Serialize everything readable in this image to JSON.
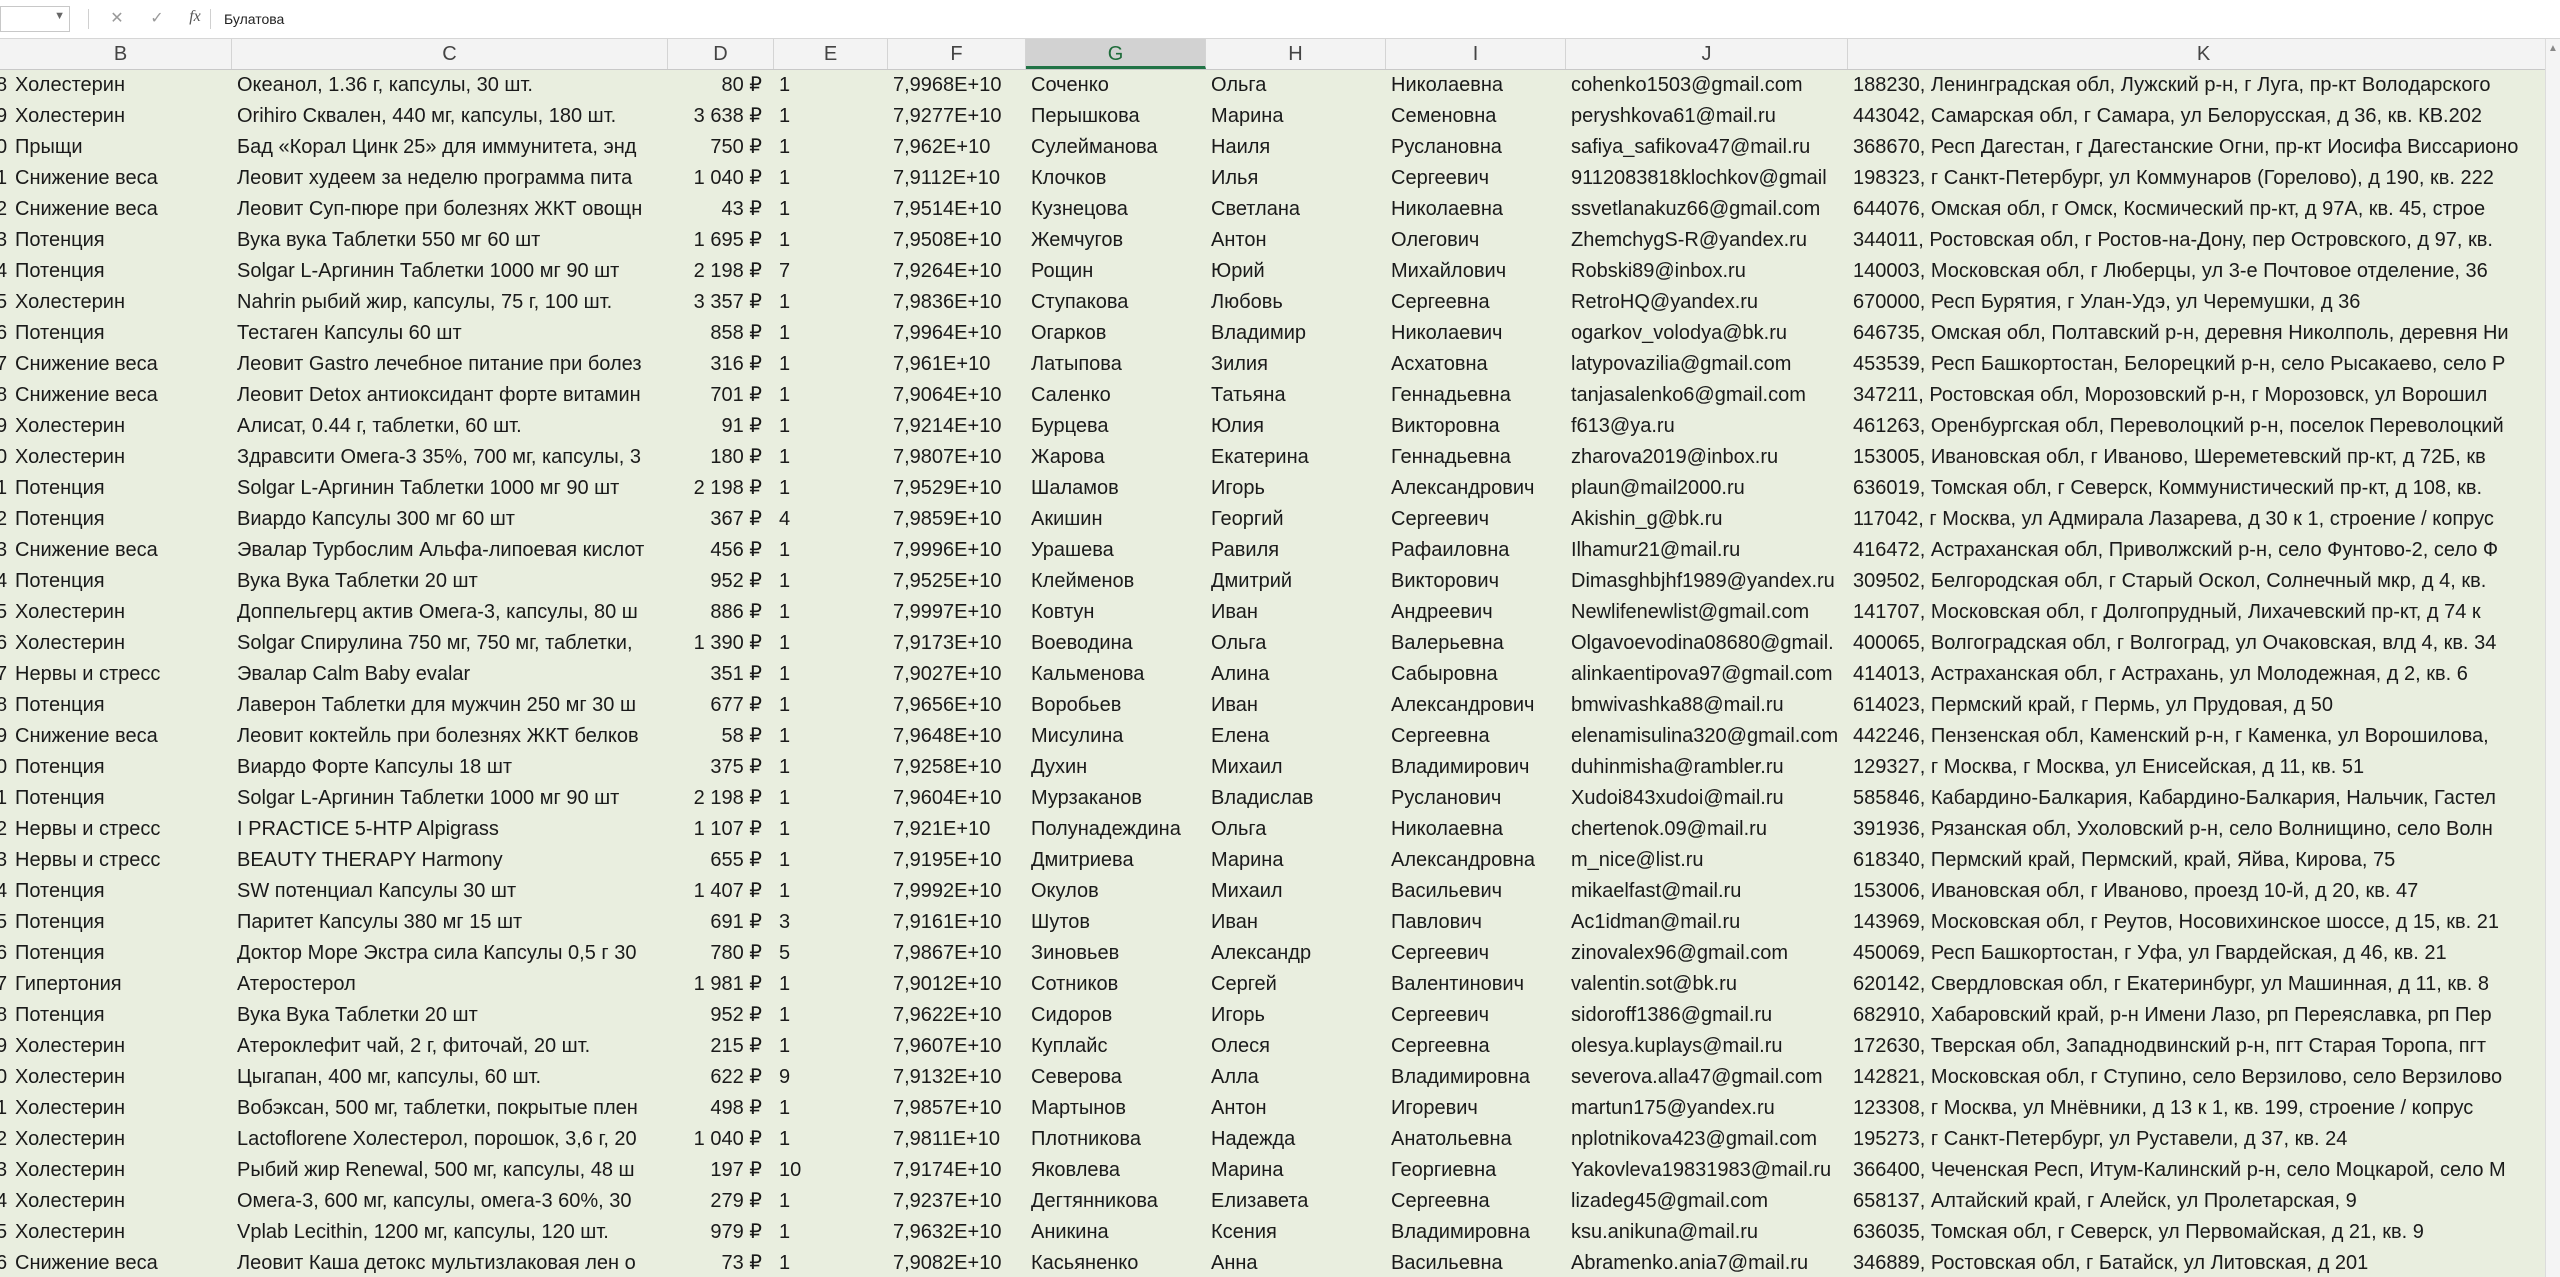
{
  "formula_bar": {
    "name_box": "",
    "cancel_icon": "close-icon",
    "enter_icon": "check-icon",
    "fx_label": "fx",
    "value": "Булатова"
  },
  "columns": [
    "B",
    "C",
    "D",
    "E",
    "F",
    "G",
    "H",
    "I",
    "J",
    "K"
  ],
  "selected_column": "G",
  "rows": [
    [
      "8",
      "Холестерин",
      "Океанол, 1.36 г, капсулы, 30 шт.",
      "80 ₽",
      "1",
      "7,9968E+10",
      "Соченко",
      "Ольга",
      "Николаевна",
      "cohenko1503@gmail.com",
      "188230, Ленинградская обл, Лужский р-н, г Луга, пр-кт Володарского"
    ],
    [
      "9",
      "Холестерин",
      "Orihiro Сквален, 440 мг, капсулы, 180 шт.",
      "3 638 ₽",
      "1",
      "7,9277E+10",
      "Перышкова",
      "Марина",
      "Семеновна",
      "peryshkova61@mail.ru",
      "443042, Самарская обл, г Самара, ул Белорусская, д 36, кв. КВ.202"
    ],
    [
      "0",
      "Прыщи",
      "Бад «Корал Цинк 25» для иммунитета, энд",
      "750 ₽",
      "1",
      "7,962E+10",
      "Сулейманова",
      "Наиля",
      "Руслановна",
      "safiya_safikova47@mail.ru",
      "368670, Респ Дагестан, г Дагестанские Огни, пр-кт Иосифа Виссарионо"
    ],
    [
      "1",
      "Снижение веса",
      "Леовит худеем за неделю программа пита",
      "1 040 ₽",
      "1",
      "7,9112E+10",
      "Клочков",
      "Илья",
      "Сергеевич",
      "9112083818klochkov@gmail",
      "198323, г Санкт-Петербург, ул Коммунаров (Горелово), д 190, кв. 222"
    ],
    [
      "2",
      "Снижение веса",
      "Леовит Суп-пюре при болезнях ЖКТ овощн",
      "43 ₽",
      "1",
      "7,9514E+10",
      "Кузнецова",
      "Светлана",
      "Николаевна",
      "ssvetlanakuz66@gmail.com",
      "644076, Омская обл, г Омск, Космический пр-кт, д 97А, кв. 45, строе"
    ],
    [
      "3",
      "Потенция",
      "Вука вука Таблетки 550 мг 60 шт",
      "1 695 ₽",
      "1",
      "7,9508E+10",
      "Жемчугов",
      "Антон",
      "Олегович",
      "ZhemchygS-R@yandex.ru",
      "344011, Ростовская обл, г Ростов-на-Дону, пер Островского, д 97, кв."
    ],
    [
      "4",
      "Потенция",
      "Solgar L-Аргинин Таблетки 1000 мг 90 шт",
      "2 198 ₽",
      "7",
      "7,9264E+10",
      "Рощин",
      "Юрий",
      "Михайлович",
      "Robski89@inbox.ru",
      "140003, Московская обл, г Люберцы, ул 3-е Почтовое отделение, 36"
    ],
    [
      "5",
      "Холестерин",
      "Nahrin рыбий жир, капсулы, 75 г, 100 шт.",
      "3 357 ₽",
      "1",
      "7,9836E+10",
      "Ступакова",
      "Любовь",
      "Сергеевна",
      "RetroHQ@yandex.ru",
      "670000, Респ Бурятия, г Улан-Удэ, ул Черемушки, д 36"
    ],
    [
      "6",
      "Потенция",
      "Тестаген Капсулы 60 шт",
      "858 ₽",
      "1",
      "7,9964E+10",
      "Огарков",
      "Владимир",
      "Николаевич",
      "ogarkov_volodya@bk.ru",
      "646735, Омская обл, Полтавский р-н, деревня Николполь, деревня Ни"
    ],
    [
      "7",
      "Снижение веса",
      "Леовит Gastro лечебное питание при болез",
      "316 ₽",
      "1",
      "7,961E+10",
      "Латыпова",
      "Зилия",
      "Асхатовна",
      "latypovazilia@gmail.com",
      "453539, Респ Башкортостан, Белорецкий р-н, село Рысакаево, село Р"
    ],
    [
      "8",
      "Снижение веса",
      "Леовит Detox антиоксидант форте витамин",
      "701 ₽",
      "1",
      "7,9064E+10",
      "Саленко",
      "Татьяна",
      "Геннадьевна",
      "tanjasalenko6@gmail.com",
      "347211, Ростовская обл, Морозовский р-н, г Морозовск, ул Ворошил"
    ],
    [
      "9",
      "Холестерин",
      "Алисат, 0.44 г, таблетки, 60 шт.",
      "91 ₽",
      "1",
      "7,9214E+10",
      "Бурцева",
      "Юлия",
      "Викторовна",
      "f613@ya.ru",
      "461263, Оренбургская обл, Переволоцкий р-н, поселок Переволоцкий"
    ],
    [
      "0",
      "Холестерин",
      "Здравсити Омега-3 35%, 700 мг, капсулы, 3",
      "180 ₽",
      "1",
      "7,9807E+10",
      "Жарова",
      "Екатерина",
      "Геннадьевна",
      "zharova2019@inbox.ru",
      "153005, Ивановская обл, г Иваново, Шереметевский пр-кт, д 72Б, кв"
    ],
    [
      "1",
      "Потенция",
      "Solgar L-Аргинин Таблетки 1000 мг 90 шт",
      "2 198 ₽",
      "1",
      "7,9529E+10",
      "Шаламов",
      "Игорь",
      "Александрович",
      "plaun@mail2000.ru",
      "636019, Томская обл, г Северск, Коммунистический пр-кт, д 108, кв."
    ],
    [
      "2",
      "Потенция",
      "Виардо Капсулы 300 мг 60 шт",
      "367 ₽",
      "4",
      "7,9859E+10",
      "Акишин",
      "Георгий",
      "Сергеевич",
      "Akishin_g@bk.ru",
      "117042, г Москва, ул Адмирала Лазарева, д 30 к 1, строение / копрус"
    ],
    [
      "3",
      "Снижение веса",
      "Эвалар Турбослим Альфа-липоевая кислот",
      "456 ₽",
      "1",
      "7,9996E+10",
      "Урашева",
      "Равиля",
      "Рафаиловна",
      "Ilhamur21@mail.ru",
      "416472, Астраханская обл, Приволжский р-н, село Фунтово-2, село Ф"
    ],
    [
      "4",
      "Потенция",
      "Вука Вука Таблетки 20 шт",
      "952 ₽",
      "1",
      "7,9525E+10",
      "Клейменов",
      "Дмитрий",
      "Викторович",
      "Dimasghbjhf1989@yandex.ru",
      "309502, Белгородская обл, г Старый Оскол, Солнечный мкр, д 4, кв."
    ],
    [
      "5",
      "Холестерин",
      "Доппельгерц актив Омега-3, капсулы, 80 ш",
      "886 ₽",
      "1",
      "7,9997E+10",
      "Ковтун",
      "Иван",
      "Андреевич",
      "Newlifenewlist@gmail.com",
      "141707, Московская обл, г Долгопрудный, Лихачевский пр-кт, д 74 к"
    ],
    [
      "6",
      "Холестерин",
      "Solgar Спирулина 750 мг, 750 мг, таблетки,",
      "1 390 ₽",
      "1",
      "7,9173E+10",
      "Воеводина",
      "Ольга",
      "Валерьевна",
      "Olgavoevodina08680@gmail.",
      "400065, Волгоградская обл, г Волгоград, ул Очаковская, влд 4, кв. 34"
    ],
    [
      "7",
      "Нервы и стресс",
      "Эвалар Calm Baby evalar",
      "351 ₽",
      "1",
      "7,9027E+10",
      "Кальменова",
      "Алина",
      "Сабыровна",
      "alinkaentipova97@gmail.com",
      "414013, Астраханская обл, г Астрахань, ул Молодежная, д 2, кв. 6"
    ],
    [
      "8",
      "Потенция",
      "Лаверон Таблетки для мужчин 250 мг 30 ш",
      "677 ₽",
      "1",
      "7,9656E+10",
      "Воробьев",
      "Иван",
      "Александрович",
      "bmwivashka88@mail.ru",
      "614023, Пермский край, г Пермь, ул Прудовая, д 50"
    ],
    [
      "9",
      "Снижение веса",
      "Леовит коктейль при болезнях ЖКТ белков",
      "58 ₽",
      "1",
      "7,9648E+10",
      "Мисулина",
      "Елена",
      "Сергеевна",
      "elenamisulina320@gmail.com",
      "442246, Пензенская обл, Каменский р-н, г Каменка, ул Ворошилова,"
    ],
    [
      "0",
      "Потенция",
      "Виардо Форте Капсулы 18 шт",
      "375 ₽",
      "1",
      "7,9258E+10",
      "Духин",
      "Михаил",
      "Владимирович",
      "duhinmisha@rambler.ru",
      "129327, г Москва, г Москва, ул Енисейская, д 11, кв. 51"
    ],
    [
      "1",
      "Потенция",
      "Solgar L-Аргинин Таблетки 1000 мг 90 шт",
      "2 198 ₽",
      "1",
      "7,9604E+10",
      "Мурзаканов",
      "Владислав",
      "Русланович",
      "Xudoi843xudoi@mail.ru",
      "585846, Кабардино-Балкария, Кабардино-Балкария, Нальчик, Гастел"
    ],
    [
      "2",
      "Нервы и стресс",
      "I PRACTICE 5-HTP Alpigrass",
      "1 107 ₽",
      "1",
      "7,921E+10",
      "Полунадеждина",
      "Ольга",
      "Николаевна",
      "chertenok.09@mail.ru",
      "391936, Рязанская обл, Ухоловский р-н, село Волнищино, село Волн"
    ],
    [
      "3",
      "Нервы и стресс",
      "BEAUTY THERAPY Harmony",
      "655 ₽",
      "1",
      "7,9195E+10",
      "Дмитриева",
      "Марина",
      "Александровна",
      "m_nice@list.ru",
      "618340, Пермский край, Пермский, край, Яйва, Кирова, 75"
    ],
    [
      "4",
      "Потенция",
      "SW потенциал Капсулы 30 шт",
      "1 407 ₽",
      "1",
      "7,9992E+10",
      "Окулов",
      "Михаил",
      "Васильевич",
      "mikaelfast@mail.ru",
      "153006, Ивановская обл, г Иваново, проезд 10-й, д 20, кв. 47"
    ],
    [
      "5",
      "Потенция",
      "Паритет Капсулы 380 мг 15 шт",
      "691 ₽",
      "3",
      "7,9161E+10",
      "Шутов",
      "Иван",
      "Павлович",
      "Ac1idman@mail.ru",
      "143969, Московская обл, г Реутов, Носовихинское шоссе, д 15, кв. 21"
    ],
    [
      "6",
      "Потенция",
      "Доктор Море Экстра сила Капсулы 0,5 г 30",
      "780 ₽",
      "5",
      "7,9867E+10",
      "Зиновьев",
      "Александр",
      "Сергеевич",
      "zinovalex96@gmail.com",
      "450069, Респ Башкортостан, г Уфа, ул Гвардейская, д 46, кв. 21"
    ],
    [
      "7",
      "Гипертония",
      "Атеростерол",
      "1 981 ₽",
      "1",
      "7,9012E+10",
      "Сотников",
      "Сергей",
      "Валентинович",
      "valentin.sot@bk.ru",
      "620142, Свердловская обл, г Екатеринбург, ул Машинная, д 11, кв. 8"
    ],
    [
      "8",
      "Потенция",
      "Вука Вука Таблетки 20 шт",
      "952 ₽",
      "1",
      "7,9622E+10",
      "Сидоров",
      "Игорь",
      "Сергеевич",
      "sidoroff1386@gmail.ru",
      "682910, Хабаровский край, р-н Имени Лазо, рп Переяславка, рп Пер"
    ],
    [
      "9",
      "Холестерин",
      "Атероклефит чай, 2 г, фиточай, 20 шт.",
      "215 ₽",
      "1",
      "7,9607E+10",
      "Куплайс",
      "Олеся",
      "Сергеевна",
      "olesya.kuplays@mail.ru",
      "172630, Тверская обл, Западнодвинский р-н, пгт Старая Торопа, пгт"
    ],
    [
      "0",
      "Холестерин",
      "Цыгапан, 400 мг, капсулы, 60 шт.",
      "622 ₽",
      "9",
      "7,9132E+10",
      "Северова",
      "Алла",
      "Владимировна",
      "severova.alla47@gmail.com",
      "142821, Московская обл, г Ступино, село Верзилово, село Верзилово"
    ],
    [
      "1",
      "Холестерин",
      "Вобэксан, 500 мг, таблетки, покрытые плен",
      "498 ₽",
      "1",
      "7,9857E+10",
      "Мартынов",
      "Антон",
      "Игоревич",
      "martun175@yandex.ru",
      "123308, г Москва, ул Мнёвники, д 13 к 1, кв. 199, строение / копрус"
    ],
    [
      "2",
      "Холестерин",
      "Lactoflorene Холестерол, порошок, 3,6 г, 20",
      "1 040 ₽",
      "1",
      "7,9811E+10",
      "Плотникова",
      "Надежда",
      "Анатольевна",
      "nplotnikova423@gmail.com",
      "195273, г Санкт-Петербург, ул Руставели, д 37, кв. 24"
    ],
    [
      "3",
      "Холестерин",
      "Рыбий жир Renewal, 500 мг, капсулы, 48 ш",
      "197 ₽",
      "10",
      "7,9174E+10",
      "Яковлева",
      "Марина",
      "Георгиевна",
      "Yakovleva19831983@mail.ru",
      "366400, Чеченская Респ, Итум-Калинский р-н, село Моцкарой, село М"
    ],
    [
      "4",
      "Холестерин",
      "Омега-3, 600 мг, капсулы, омега-3 60%, 30",
      "279 ₽",
      "1",
      "7,9237E+10",
      "Дегтянникова",
      "Елизавета",
      "Сергеевна",
      "lizadeg45@gmail.com",
      "658137, Алтайский край, г Алейск, ул Пролетарская, 9"
    ],
    [
      "5",
      "Холестерин",
      "Vplab Lecithin, 1200 мг, капсулы, 120 шт.",
      "979 ₽",
      "1",
      "7,9632E+10",
      "Аникина",
      "Ксения",
      "Владимировна",
      "ksu.anikuna@mail.ru",
      "636035, Томская обл, г Северск, ул Первомайская, д 21, кв. 9"
    ],
    [
      "6",
      "Снижение веса",
      "Леовит Каша детокс мультизлаковая лен о",
      "73 ₽",
      "1",
      "7,9082E+10",
      "Касьяненко",
      "Анна",
      "Васильевна",
      "Abramenko.ania7@mail.ru",
      "346889, Ростовская обл, г Батайск, ул Литовская, д 201"
    ]
  ]
}
